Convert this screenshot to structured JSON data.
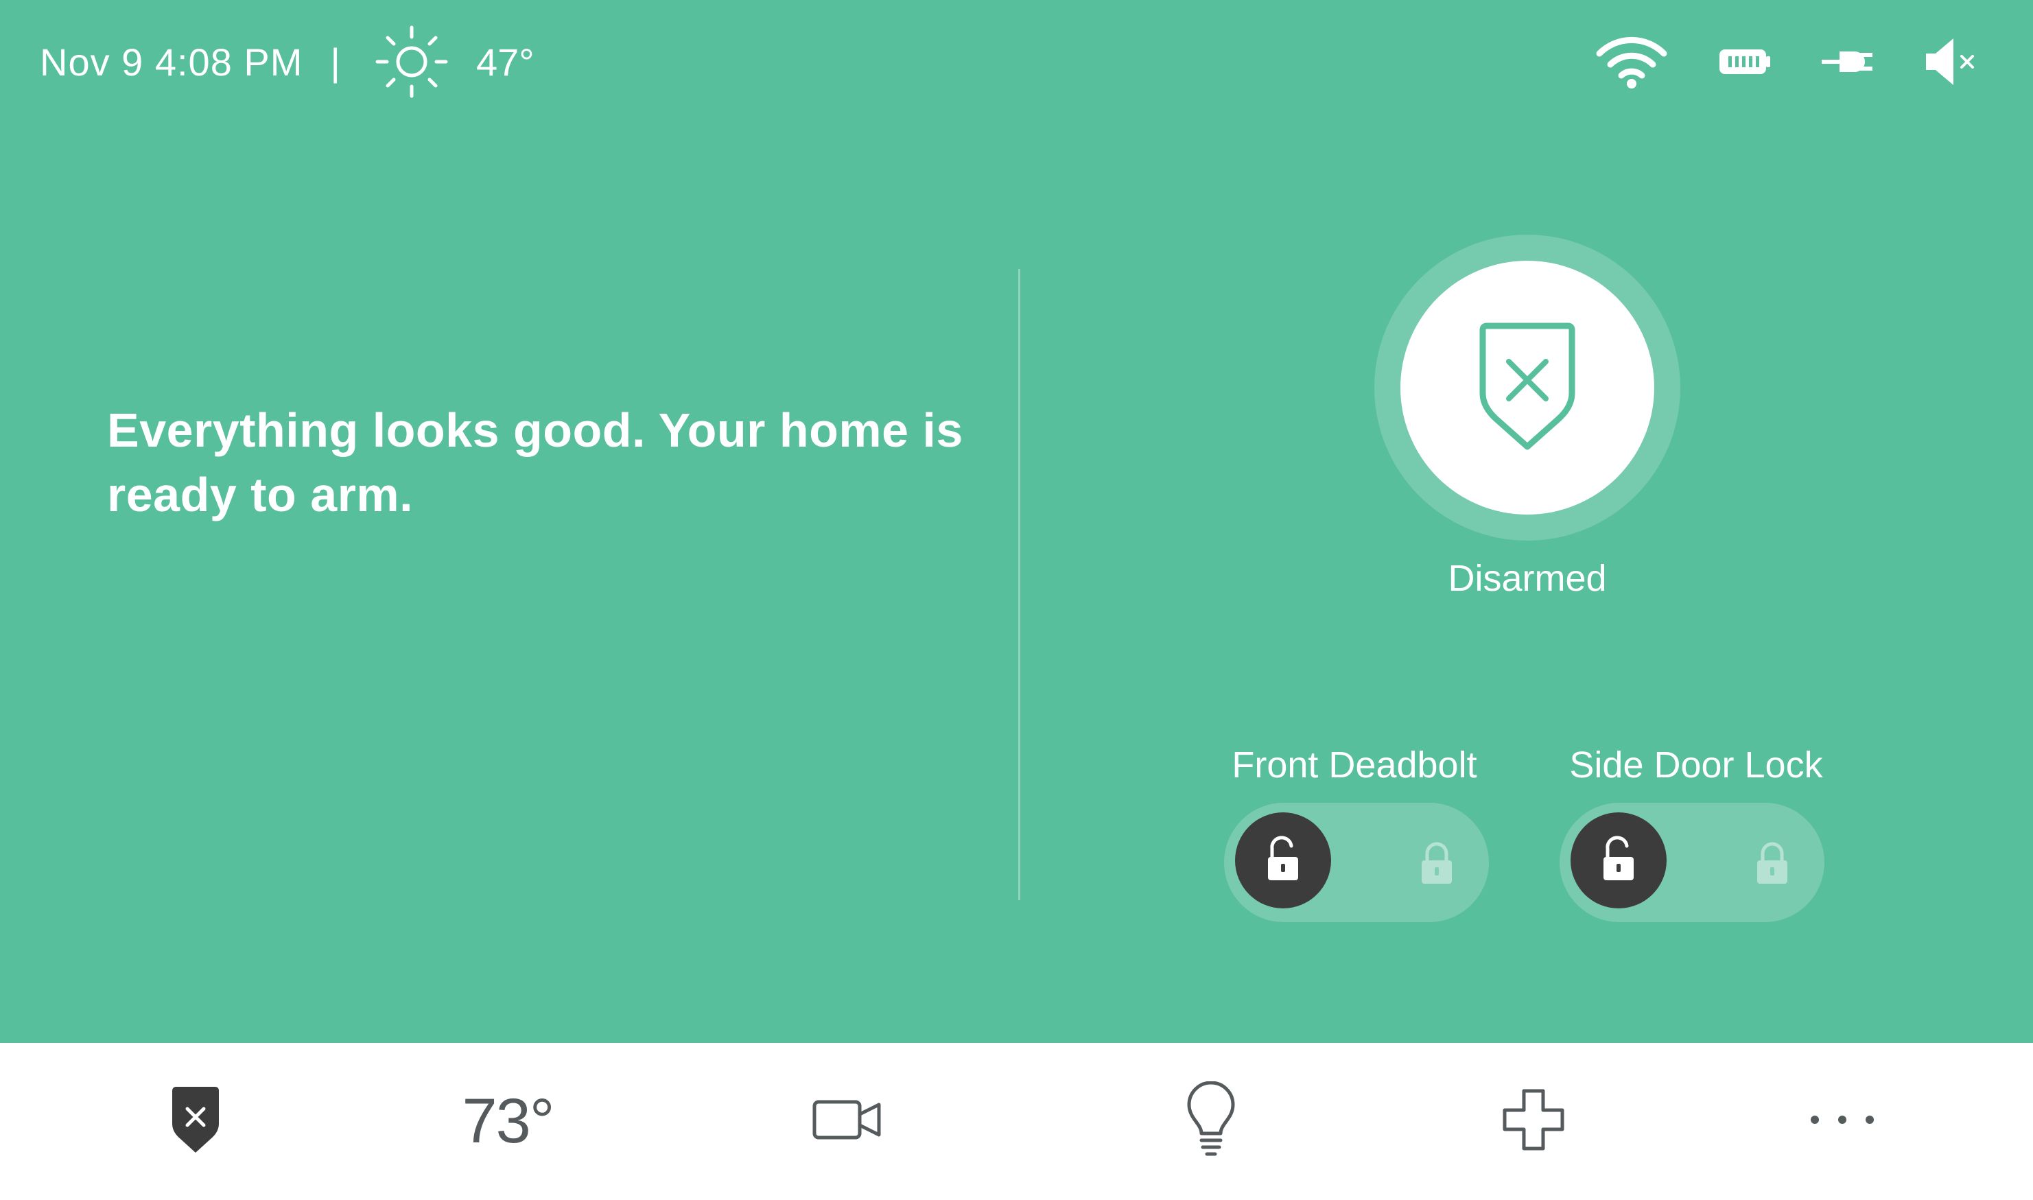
{
  "status_bar": {
    "datetime": "Nov 9 4:08 PM",
    "separator": "|",
    "weather_icon": "sun-icon",
    "outdoor_temp": "47°",
    "icons": [
      "wifi-icon",
      "battery-icon",
      "plug-icon",
      "speaker-muted-icon"
    ]
  },
  "main": {
    "message": "Everything looks good. Your home is ready to arm.",
    "arm_state": {
      "icon": "shield-x-icon",
      "label": "Disarmed"
    },
    "locks": [
      {
        "label": "Front Deadbolt",
        "state": "unlocked"
      },
      {
        "label": "Side Door Lock",
        "state": "unlocked"
      }
    ]
  },
  "nav": {
    "items": [
      {
        "name": "security",
        "icon": "shield-x-icon",
        "active": true
      },
      {
        "name": "thermostat",
        "label": "73°"
      },
      {
        "name": "cameras",
        "icon": "video-camera-icon"
      },
      {
        "name": "lights",
        "icon": "lightbulb-icon"
      },
      {
        "name": "health",
        "icon": "medical-cross-icon"
      },
      {
        "name": "more",
        "icon": "more-dots-icon"
      }
    ]
  },
  "colors": {
    "background": "#58bf9c",
    "white": "#ffffff",
    "dark": "#3c3c3c",
    "nav_icon": "#555a5c"
  }
}
